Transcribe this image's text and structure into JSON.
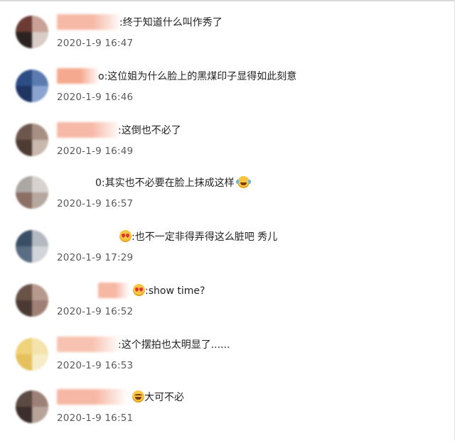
{
  "comments": [
    {
      "text": ":终于知道什么叫作秀了",
      "emoji": "",
      "tail": "",
      "time": "2020-1-9 16:47",
      "avatar_colors": [
        "#6b3b34",
        "#c9a197",
        "#2c2222",
        "#d9cbc6"
      ],
      "name_color": "#f6b9a6"
    },
    {
      "text": "o:这位姐为什么脸上的黑煤印子显得如此刻意",
      "emoji": "",
      "tail": "",
      "time": "2020-1-9 16:46",
      "avatar_colors": [
        "#2d4d86",
        "#5b7bb0",
        "#1f3663",
        "#8aa4cf"
      ],
      "name_color": "#f5a98f"
    },
    {
      "text": ":这倒也不必了",
      "emoji": "",
      "tail": "",
      "time": "2020-1-9 16:49",
      "avatar_colors": [
        "#6d574d",
        "#a78f84",
        "#4e3b33",
        "#c9b8ae"
      ],
      "name_color": "#f7b9a7"
    },
    {
      "text": "0:其实也不必要在脸上抹成这样",
      "emoji": "cry-laugh",
      "tail": "",
      "time": "2020-1-9 16:57",
      "avatar_colors": [
        "#ada7a4",
        "#d7d2cf",
        "#8c6f65",
        "#b6a89e"
      ],
      "name_color": "#ffffff"
    },
    {
      "text": ":也不一定非得弄得这么脏吧 秀儿",
      "emoji": "heart-eyes",
      "tail": "",
      "time": "2020-1-9 17:29",
      "avatar_colors": [
        "#3a4f66",
        "#b4b8c0",
        "#5a6d83",
        "#d1d4d9"
      ],
      "name_color": "#ffffff"
    },
    {
      "text": ":show time?",
      "emoji": "heart-eyes",
      "tail": "",
      "time": "2020-1-9 16:52",
      "avatar_colors": [
        "#6a5247",
        "#b79a8e",
        "#4a3a33",
        "#a08075"
      ],
      "name_color": "#f6b7a3"
    },
    {
      "text": ":这个摆拍也太明显了......",
      "emoji": "",
      "tail": "",
      "time": "2020-1-9 16:53",
      "avatar_colors": [
        "#f0d27a",
        "#f4e2ac",
        "#e6c05c",
        "#f7ecc8"
      ],
      "name_color": "#f8c2b1"
    },
    {
      "text": "",
      "emoji": "laugh",
      "tail": "大可不必",
      "time": "2020-1-9 16:51",
      "avatar_colors": [
        "#5b4943",
        "#9d8178",
        "#3c2f2b",
        "#b7a39a"
      ],
      "name_color": "#f6b8a5"
    }
  ]
}
